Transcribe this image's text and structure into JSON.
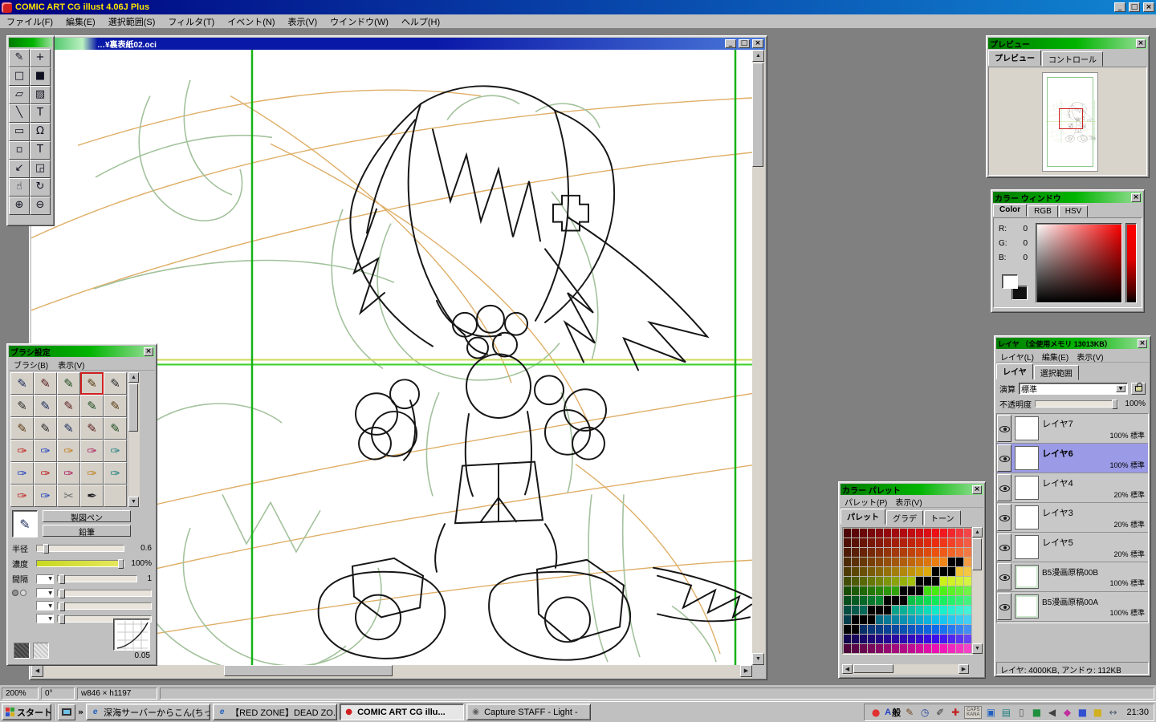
{
  "icons": {
    "minimize": "_",
    "maximize": "□",
    "close": "×",
    "scroll_up": "▲",
    "scroll_down": "▼",
    "scroll_left": "◀",
    "scroll_right": "▶",
    "dropdown": "▼",
    "overflow": "»"
  },
  "app": {
    "title": "COMIC ART CG illust 4.06J Plus"
  },
  "menu_bar": {
    "items": [
      "ファイル(F)",
      "編集(E)",
      "選択範囲(S)",
      "フィルタ(T)",
      "イベント(N)",
      "表示(V)",
      "ウインドウ(W)",
      "ヘルプ(H)"
    ]
  },
  "tools": {
    "items": [
      {
        "name": "pen-tool",
        "glyph": "✎"
      },
      {
        "name": "move-tool",
        "glyph": "+"
      },
      {
        "name": "select-rect-tool",
        "glyph": "□"
      },
      {
        "name": "fill-tool",
        "glyph": "■"
      },
      {
        "name": "eraser-tool",
        "glyph": "▱"
      },
      {
        "name": "tone-tool",
        "glyph": "▨"
      },
      {
        "name": "line-tool",
        "glyph": "╲"
      },
      {
        "name": "text-tool",
        "glyph": "T"
      },
      {
        "name": "marquee-tool",
        "glyph": "▭"
      },
      {
        "name": "lasso-tool",
        "glyph": "Ω"
      },
      {
        "name": "polygon-select-tool",
        "glyph": "▫"
      },
      {
        "name": "text-vertical-tool",
        "glyph": "T"
      },
      {
        "name": "eyedropper-tool",
        "glyph": "↙"
      },
      {
        "name": "transform-tool",
        "glyph": "◲"
      },
      {
        "name": "hand-tool",
        "glyph": "☝"
      },
      {
        "name": "rotate-tool",
        "glyph": "↻"
      },
      {
        "name": "zoom-in-tool",
        "glyph": "⊕"
      },
      {
        "name": "zoom-out-tool",
        "glyph": "⊖"
      }
    ]
  },
  "canvas_window": {
    "title": "…¥裏表紙02.oci"
  },
  "brush_window": {
    "title": "ブラシ設定",
    "menu": [
      "ブラシ(B)",
      "表示(V)"
    ],
    "selected_index": 3,
    "cells": [
      {
        "glyph": "✎",
        "color": "#1a2a5a"
      },
      {
        "glyph": "✎",
        "color": "#5a1a1a"
      },
      {
        "glyph": "✎",
        "color": "#1a4a1a"
      },
      {
        "glyph": "✎",
        "color": "#5a3a10"
      },
      {
        "glyph": "✎",
        "color": "#2a2a2a"
      },
      {
        "glyph": "✎",
        "color": "#2a2a2a"
      },
      {
        "glyph": "✎",
        "color": "#1a2a5a"
      },
      {
        "glyph": "✎",
        "color": "#5a1a1a"
      },
      {
        "glyph": "✎",
        "color": "#1a4a1a"
      },
      {
        "glyph": "✎",
        "color": "#5a3a10"
      },
      {
        "glyph": "✎",
        "color": "#5a3a10"
      },
      {
        "glyph": "✎",
        "color": "#2a2a2a"
      },
      {
        "glyph": "✎",
        "color": "#1a2a5a"
      },
      {
        "glyph": "✎",
        "color": "#5a1a1a"
      },
      {
        "glyph": "✎",
        "color": "#1a4a1a"
      },
      {
        "glyph": "✑",
        "color": "#c02020"
      },
      {
        "glyph": "✑",
        "color": "#2040c0"
      },
      {
        "glyph": "✑",
        "color": "#c08020"
      },
      {
        "glyph": "✑",
        "color": "#b02060"
      },
      {
        "glyph": "✑",
        "color": "#208080"
      },
      {
        "glyph": "✑",
        "color": "#2040c0"
      },
      {
        "glyph": "✑",
        "color": "#c02020"
      },
      {
        "glyph": "✑",
        "color": "#b02060"
      },
      {
        "glyph": "✑",
        "color": "#c08020"
      },
      {
        "glyph": "✑",
        "color": "#208080"
      },
      {
        "glyph": "✑",
        "color": "#c02020"
      },
      {
        "glyph": "✑",
        "color": "#2040c0"
      },
      {
        "glyph": "✂",
        "color": "#707070"
      },
      {
        "glyph": "✒",
        "color": "#202020"
      },
      {
        "glyph": "",
        "color": "#c0c0c0"
      }
    ],
    "pen_button": "製図ペン",
    "pencil_button": "鉛筆",
    "radius_label": "半径",
    "radius_value": "0.6",
    "density_label": "濃度",
    "density_value": "100%",
    "spacing_label": "間隔",
    "spacing_value": "1",
    "curve_value": "0.05"
  },
  "preview_window": {
    "title": "プレビュー",
    "tabs": [
      "プレビュー",
      "コントロール"
    ]
  },
  "color_window": {
    "title": "カラー ウィンドウ",
    "tabs": [
      "Color",
      "RGB",
      "HSV"
    ],
    "r_label": "R:",
    "r_value": "0",
    "g_label": "G:",
    "g_value": "0",
    "b_label": "B:",
    "b_value": "0"
  },
  "layer_window": {
    "title": "レイヤ （全使用メモリ 13013KB）",
    "menu": [
      "レイヤ(L)",
      "編集(E)",
      "表示(V)"
    ],
    "tabs": [
      "レイヤ",
      "選択範囲"
    ],
    "blend_label": "演算",
    "blend_value": "標準",
    "opacity_label": "不透明度",
    "opacity_value": "100%",
    "layers": [
      {
        "name": "レイヤ7",
        "info": "100% 標準",
        "selected": false
      },
      {
        "name": "レイヤ6",
        "info": "100% 標準",
        "selected": true
      },
      {
        "name": "レイヤ4",
        "info": "20% 標準",
        "selected": false
      },
      {
        "name": "レイヤ3",
        "info": "20% 標準",
        "selected": false
      },
      {
        "name": "レイヤ5",
        "info": "20% 標準",
        "selected": false
      },
      {
        "name": "B5漫画原稿00B",
        "info": "100% 標準",
        "selected": false
      },
      {
        "name": "B5漫画原稿00A",
        "info": "100% 標準",
        "selected": false
      }
    ],
    "status": "レイヤ: 4000KB, アンドゥ: 112KB"
  },
  "palette_window": {
    "title": "カラー パレット",
    "menu": [
      "パレット(P)",
      "表示(V)"
    ],
    "tabs": [
      "パレット",
      "グラデ",
      "トーン"
    ],
    "grid": {
      "rows": 13,
      "cols": 16,
      "row_hues": [
        358,
        8,
        18,
        30,
        45,
        70,
        105,
        140,
        170,
        192,
        215,
        252,
        315
      ],
      "saturation": 88,
      "lightness_start": 16,
      "lightness_step": 3,
      "black_cells": {
        "3": [
          13,
          14
        ],
        "4": [
          11,
          12,
          13
        ],
        "5": [
          9,
          10,
          11
        ],
        "6": [
          7,
          8,
          9
        ],
        "7": [
          5,
          6,
          7
        ],
        "8": [
          3,
          4,
          5
        ],
        "9": [
          1,
          2,
          3
        ],
        "10": [
          0,
          1
        ]
      }
    }
  },
  "status_bar": {
    "zoom": "200%",
    "angle": "0°",
    "size": "w846 × h1197"
  },
  "taskbar": {
    "start": "スタート",
    "tasks": [
      {
        "label": "深海サーバーからこん(ちっ...",
        "icon_glyph": "e",
        "icon_color": "#2060c0",
        "active": false
      },
      {
        "label": "【RED ZONE】DEAD ZO...",
        "icon_glyph": "e",
        "icon_color": "#2060c0",
        "active": false
      },
      {
        "label": "COMIC ART CG illu...",
        "icon_glyph": "●",
        "icon_color": "#d02020",
        "active": true
      },
      {
        "label": "Capture STAFF - Light -",
        "icon_glyph": "◉",
        "icon_color": "#606060",
        "active": false
      }
    ],
    "ime_a": "A",
    "ime_mode": "般",
    "caps": "CAPS",
    "kana": "KANA",
    "clock": "21:30",
    "tray_left": [
      {
        "name": "red-ball-icon",
        "glyph": "●",
        "color": "#e03030"
      }
    ],
    "tray_mid": [
      {
        "name": "ime-pen-icon",
        "glyph": "✎",
        "color": "#704820"
      },
      {
        "name": "clock-utility-icon",
        "glyph": "◷",
        "color": "#2040a0"
      },
      {
        "name": "stylus-icon",
        "glyph": "✐",
        "color": "#303030"
      },
      {
        "name": "shield-icon",
        "glyph": "✚",
        "color": "#c02020"
      }
    ],
    "tray_right": [
      {
        "name": "monitor-settings-icon",
        "glyph": "▣",
        "color": "#2060c0"
      },
      {
        "name": "network-icon",
        "glyph": "▤",
        "color": "#208080"
      },
      {
        "name": "document-icon",
        "glyph": "▯",
        "color": "#606060"
      },
      {
        "name": "green-chip-icon",
        "glyph": "■",
        "color": "#209040"
      },
      {
        "name": "volume-icon",
        "glyph": "◀",
        "color": "#404040"
      },
      {
        "name": "messenger-icon",
        "glyph": "◆",
        "color": "#c030a0"
      },
      {
        "name": "blue-chip-icon",
        "glyph": "■",
        "color": "#3050d0"
      },
      {
        "name": "gold-chip-icon",
        "glyph": "■",
        "color": "#d0b020"
      },
      {
        "name": "usb-icon",
        "glyph": "↔",
        "color": "#506070"
      }
    ]
  }
}
